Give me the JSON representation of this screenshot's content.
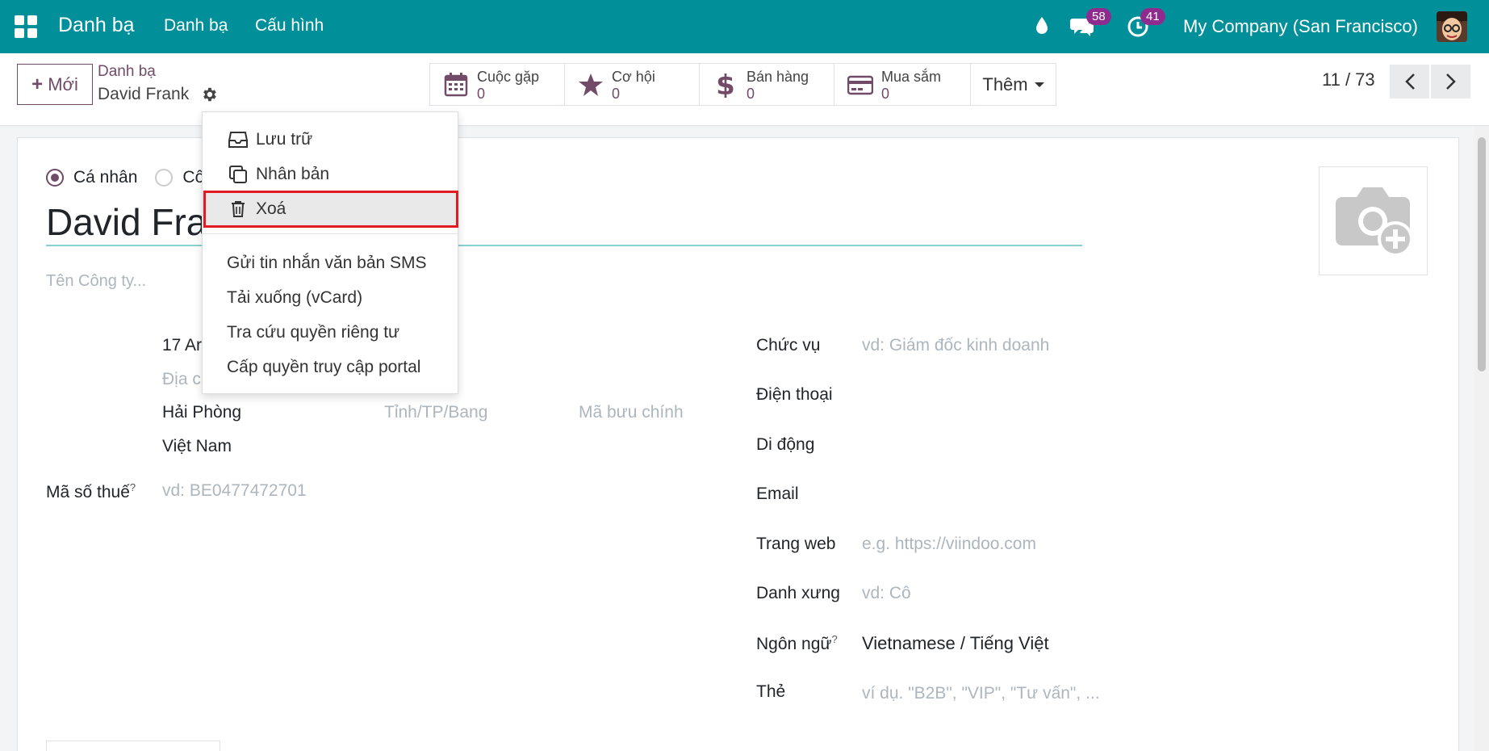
{
  "navbar": {
    "brand": "Danh bạ",
    "menu": [
      "Danh bạ",
      "Cấu hình"
    ],
    "messages_count": "58",
    "activities_count": "41",
    "company": "My Company (San Francisco)",
    "bg_color": "#01909a"
  },
  "control": {
    "new_label": "Mới",
    "breadcrumb_parent": "Danh bạ",
    "breadcrumb_current": "David Frank",
    "smart_buttons": [
      {
        "icon": "calendar-icon",
        "title": "Cuộc gặp",
        "value": "0"
      },
      {
        "icon": "star-icon",
        "title": "Cơ hội",
        "value": "0"
      },
      {
        "icon": "dollar-icon",
        "title": "Bán hàng",
        "value": "0"
      },
      {
        "icon": "credit-card-icon",
        "title": "Mua sắm",
        "value": "0"
      }
    ],
    "more_label": "Thêm",
    "pager": "11 / 73"
  },
  "form": {
    "type_individual": "Cá nhân",
    "type_company_partial": "Cô",
    "name": "David Fra",
    "company_placeholder": "Tên Công ty...",
    "street": "17 Ar",
    "street2_placeholder": "Địa c",
    "city": "Hải Phòng",
    "state_placeholder": "Tỉnh/TP/Bang",
    "zip_placeholder": "Mã bưu chính",
    "country": "Việt Nam",
    "vat_label": "Mã số thuế",
    "vat_placeholder": "vd: BE0477472701",
    "job_label": "Chức vụ",
    "job_placeholder": "vd: Giám đốc kinh doanh",
    "phone_label": "Điện thoại",
    "mobile_label": "Di động",
    "email_label": "Email",
    "website_label": "Trang web",
    "website_placeholder": "e.g. https://viindoo.com",
    "title_label": "Danh xưng",
    "title_placeholder": "vd: Cô",
    "lang_label": "Ngôn ngữ",
    "lang_value": "Vietnamese / Tiếng Việt",
    "tags_label": "Thẻ",
    "tags_placeholder": "ví dụ. \"B2B\", \"VIP\", \"Tư vấn\", ..."
  },
  "dropdown": {
    "items": [
      {
        "icon": "inbox-icon",
        "label": "Lưu trữ"
      },
      {
        "icon": "copy-icon",
        "label": "Nhân bản"
      },
      {
        "icon": "trash-icon",
        "label": "Xoá"
      }
    ],
    "actions": [
      "Gửi tin nhắn văn bản SMS",
      "Tải xuống (vCard)",
      "Tra cứu quyền riêng tư",
      "Cấp quyền truy cập portal"
    ],
    "highlight_color": "#e11b22"
  }
}
